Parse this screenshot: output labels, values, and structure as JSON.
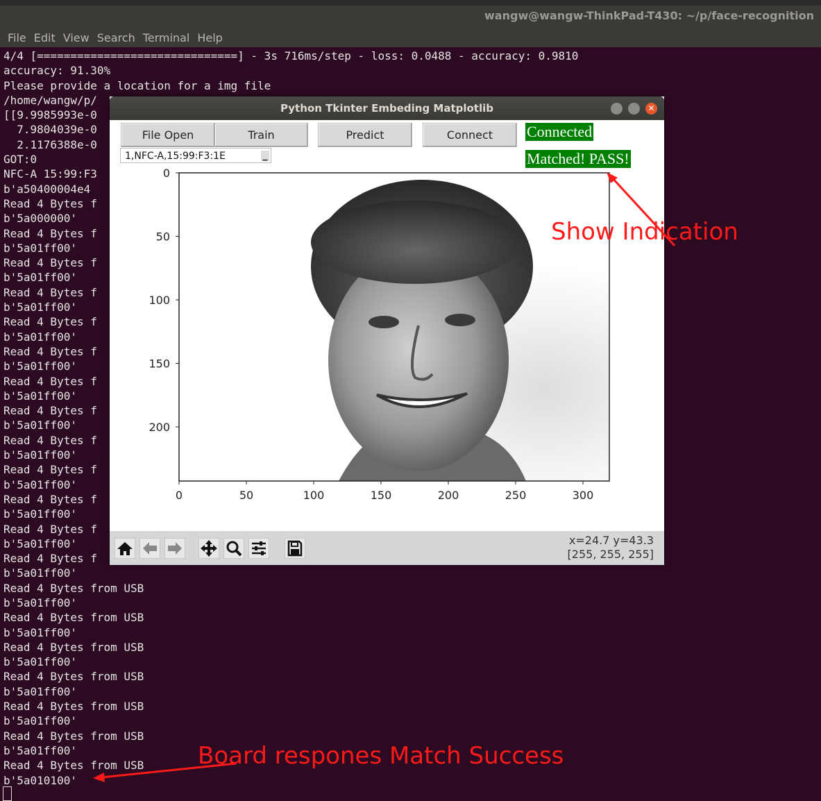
{
  "terminal": {
    "title": "wangw@wangw-ThinkPad-T430: ~/p/face-recognition",
    "menu": [
      "File",
      "Edit",
      "View",
      "Search",
      "Terminal",
      "Help"
    ],
    "lines": [
      "4/4 [==============================] - 3s 716ms/step - loss: 0.0488 - accuracy: 0.9810",
      "accuracy: 91.30%",
      "Please provide a location for a img file",
      "/home/wangw/p/",
      "[[9.9985993e-0",
      "  7.9804039e-0",
      "  2.1176388e-0",
      "GOT:0",
      "NFC-A 15:99:F3",
      "b'a50400004e4",
      "Read 4 Bytes f",
      "b'5a000000'",
      "Read 4 Bytes f",
      "b'5a01ff00'",
      "Read 4 Bytes f",
      "b'5a01ff00'",
      "Read 4 Bytes f",
      "b'5a01ff00'",
      "Read 4 Bytes f",
      "b'5a01ff00'",
      "Read 4 Bytes f",
      "b'5a01ff00'",
      "Read 4 Bytes f",
      "b'5a01ff00'",
      "Read 4 Bytes f",
      "b'5a01ff00'",
      "Read 4 Bytes f",
      "b'5a01ff00'",
      "Read 4 Bytes f",
      "b'5a01ff00'",
      "Read 4 Bytes f",
      "b'5a01ff00'",
      "Read 4 Bytes f",
      "b'5a01ff00'",
      "Read 4 Bytes f",
      "b'5a01ff00'",
      "Read 4 Bytes from USB",
      "b'5a01ff00'",
      "Read 4 Bytes from USB",
      "b'5a01ff00'",
      "Read 4 Bytes from USB",
      "b'5a01ff00'",
      "Read 4 Bytes from USB",
      "b'5a01ff00'",
      "Read 4 Bytes from USB",
      "b'5a01ff00'",
      "Read 4 Bytes from USB",
      "b'5a01ff00'",
      "Read 4 Bytes from USB",
      "b'5a010100'"
    ]
  },
  "window": {
    "title": "Python Tkinter Embeding Matplotlib",
    "buttons": {
      "file_open": "File Open",
      "train": "Train",
      "predict": "Predict",
      "connect": "Connect"
    },
    "device_select": "1,NFC-A,15:99:F3:1E",
    "status_connected": "Connected",
    "status_match": "Matched! PASS!",
    "status_color": "#008000",
    "coords": "x=24.7 y=43.3",
    "pixel_value": "[255, 255, 255]",
    "toolbar_icons": [
      "home-icon",
      "back-arrow-icon",
      "forward-arrow-icon",
      "pan-icon",
      "zoom-icon",
      "subplots-icon",
      "save-icon"
    ]
  },
  "plot": {
    "x_ticks": [
      "0",
      "50",
      "100",
      "150",
      "200",
      "250",
      "300"
    ],
    "y_ticks": [
      "0",
      "50",
      "100",
      "150",
      "200"
    ]
  },
  "annotations": {
    "show_indication": "Show Indication",
    "board_response": "Board respones Match Success",
    "color": "#ff1a1a"
  }
}
